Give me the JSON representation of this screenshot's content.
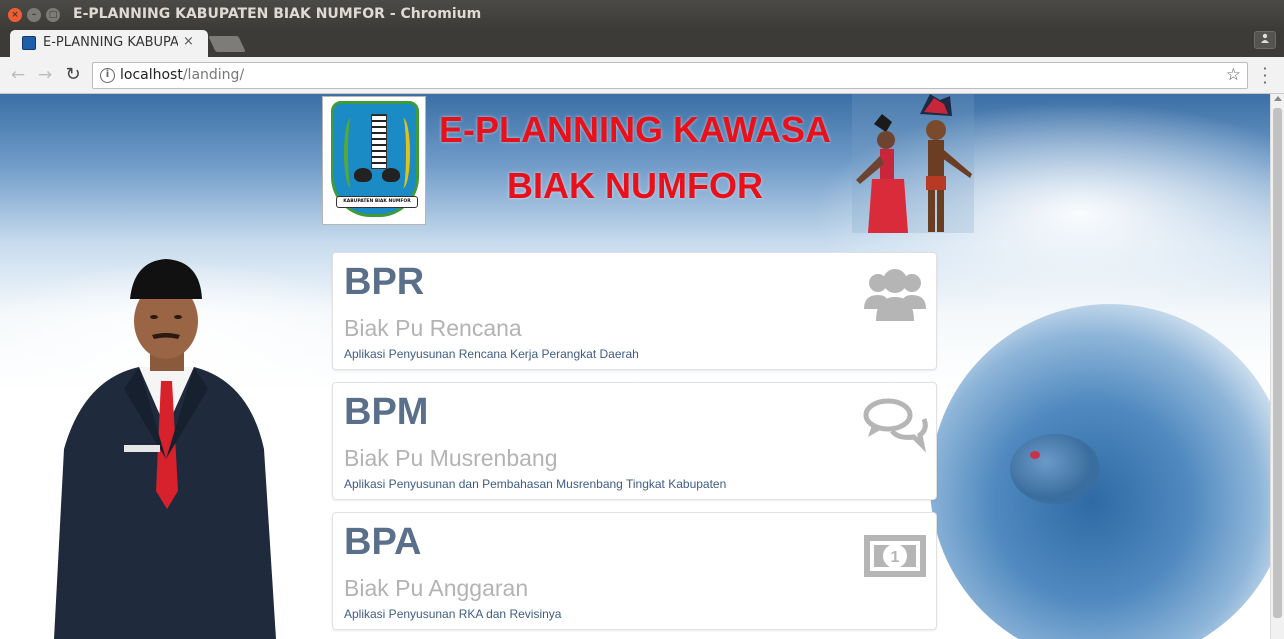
{
  "window": {
    "title": "E-PLANNING KABUPATEN BIAK NUMFOR - Chromium"
  },
  "tabs": [
    {
      "label": "E-PLANNING KABUPATEN BIAK NUMFOR",
      "close": "×"
    }
  ],
  "toolbar": {
    "url_host": "localhost",
    "url_path": "/landing/",
    "info_icon": "i"
  },
  "header": {
    "title_line1": "E-PLANNING KAWASA",
    "title_line2": "BIAK NUMFOR",
    "logo_ribbon": "KABUPATEN BIAK NUMFOR"
  },
  "cards": [
    {
      "code": "BPR",
      "name": "Biak Pu Rencana",
      "description": "Aplikasi Penyusunan Rencana Kerja Perangkat Daerah",
      "icon": "users-icon"
    },
    {
      "code": "BPM",
      "name": "Biak Pu Musrenbang",
      "description": "Aplikasi Penyusunan dan Pembahasan Musrenbang Tingkat Kabupaten",
      "icon": "comments-icon"
    },
    {
      "code": "BPA",
      "name": "Biak Pu Anggaran",
      "description": "Aplikasi Penyusunan RKA dan Revisinya",
      "icon": "money-icon",
      "icon_text": "1"
    }
  ],
  "colors": {
    "title_red": "#e8111b",
    "card_code": "#5a6f89",
    "card_name": "#b3b3b3",
    "card_desc": "#3f5c86",
    "icon_gray": "#b5b5b5"
  }
}
